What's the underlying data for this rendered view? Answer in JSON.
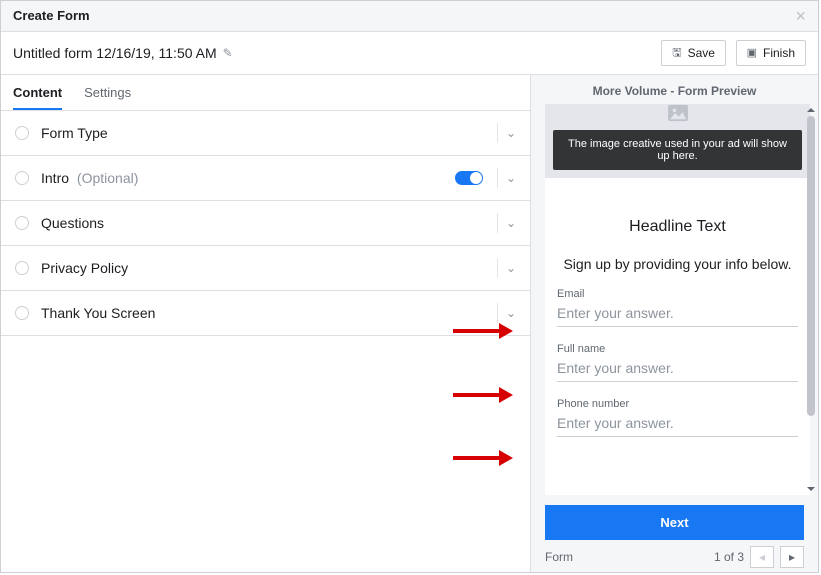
{
  "dialog": {
    "title": "Create Form"
  },
  "form": {
    "name": "Untitled form 12/16/19, 11:50 AM"
  },
  "header_buttons": {
    "save_label": "Save",
    "finish_label": "Finish"
  },
  "tabs": {
    "content": "Content",
    "settings": "Settings"
  },
  "sections": {
    "form_type": "Form Type",
    "intro": "Intro",
    "intro_optional": "(Optional)",
    "questions": "Questions",
    "privacy": "Privacy Policy",
    "thankyou": "Thank You Screen"
  },
  "preview": {
    "title": "More Volume - Form Preview",
    "creative_note": "The image creative used in your ad will show up here.",
    "headline": "Headline Text",
    "subline": "Sign up by providing your info below.",
    "fields": {
      "email_label": "Email",
      "fullname_label": "Full name",
      "phone_label": "Phone number",
      "placeholder": "Enter your answer."
    },
    "next_label": "Next",
    "pager_label": "Form",
    "pager_position": "1 of 3"
  }
}
